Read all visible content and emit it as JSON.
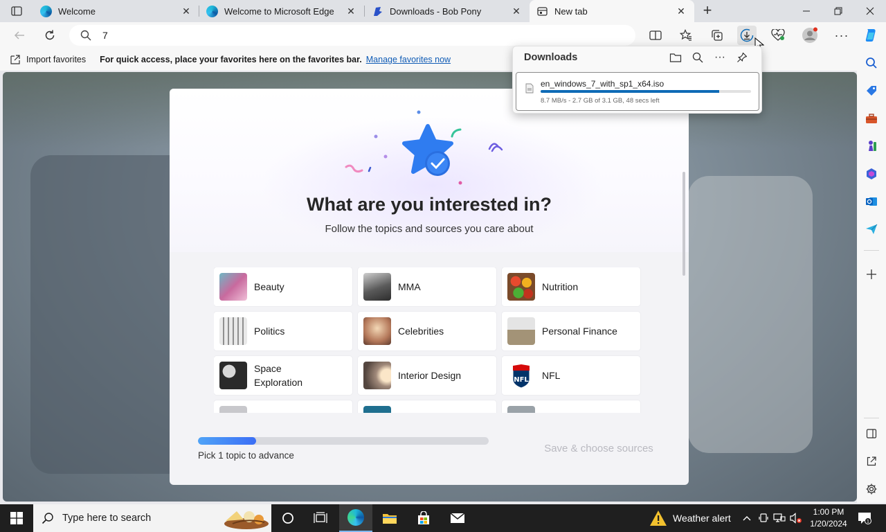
{
  "tabs": [
    {
      "title": "Welcome",
      "active": false
    },
    {
      "title": "Welcome to Microsoft Edge",
      "active": false
    },
    {
      "title": "Downloads - Bob Pony",
      "active": false
    },
    {
      "title": "New tab",
      "active": true
    }
  ],
  "address_bar": {
    "value": "7"
  },
  "favorites_bar": {
    "import_label": "Import favorites",
    "hint": "For quick access, place your favorites here on the favorites bar.",
    "manage_link": "Manage favorites now"
  },
  "modal": {
    "heading": "What are you interested in?",
    "subheading": "Follow the topics and sources you care about",
    "topics": [
      {
        "label": "Beauty"
      },
      {
        "label": "MMA"
      },
      {
        "label": "Nutrition"
      },
      {
        "label": "Politics"
      },
      {
        "label": "Celebrities"
      },
      {
        "label": "Personal Finance"
      },
      {
        "label": "Space Exploration"
      },
      {
        "label": "Interior Design"
      },
      {
        "label": "NFL"
      }
    ],
    "progress_label": "Pick 1 topic to advance",
    "progress_fraction": 0.2,
    "save_button": "Save & choose sources"
  },
  "downloads": {
    "title": "Downloads",
    "item": {
      "filename": "en_windows_7_with_sp1_x64.iso",
      "status": "8.7 MB/s - 2.7 GB of 3.1 GB, 48 secs left",
      "progress_fraction": 0.85
    }
  },
  "taskbar": {
    "search_placeholder": "Type here to search",
    "weather": "Weather alert",
    "time": "1:00 PM",
    "date": "1/20/2024"
  },
  "colors": {
    "accent": "#0e6bb6",
    "link": "#0f5bb5",
    "taskbar": "#1f1f1f"
  }
}
